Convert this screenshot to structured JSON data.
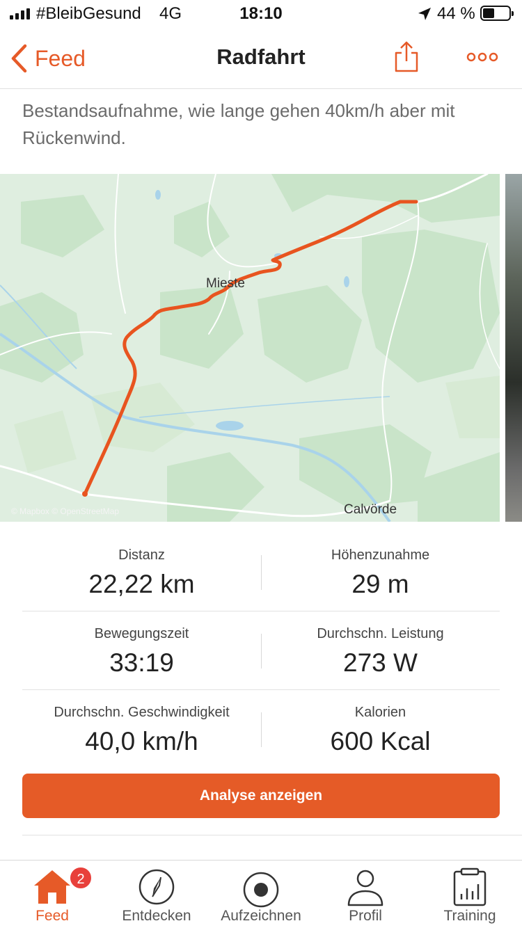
{
  "status_bar": {
    "carrier": "#BleibGesund",
    "network": "4G",
    "time": "18:10",
    "battery_percent": "44 %"
  },
  "nav": {
    "back_label": "Feed",
    "title": "Radfahrt"
  },
  "description": "Bestandsaufnahme, wie lange gehen 40km/h aber mit Rückenwind.",
  "map": {
    "labels": {
      "town_miesté": "Mieste",
      "town_calvoerde": "Calvörde"
    },
    "attribution": "© Mapbox © OpenStreetMap"
  },
  "stats": [
    {
      "left_label": "Distanz",
      "left_value": "22,22 km",
      "right_label": "Höhenzunahme",
      "right_value": "29 m"
    },
    {
      "left_label": "Bewegungszeit",
      "left_value": "33:19",
      "right_label": "Durchschn. Leistung",
      "right_value": "273 W"
    },
    {
      "left_label": "Durchschn. Geschwindigkeit",
      "left_value": "40,0 km/h",
      "right_label": "Kalorien",
      "right_value": "600 Kcal"
    }
  ],
  "analyse_button": "Analyse anzeigen",
  "tabs": [
    {
      "label": "Feed",
      "icon": "home-icon",
      "badge": "2",
      "active": true
    },
    {
      "label": "Entdecken",
      "icon": "compass-icon"
    },
    {
      "label": "Aufzeichnen",
      "icon": "record-icon"
    },
    {
      "label": "Profil",
      "icon": "profile-icon"
    },
    {
      "label": "Training",
      "icon": "training-icon"
    }
  ],
  "colors": {
    "accent": "#e65a28",
    "route": "#e8541f",
    "map_background": "#dfeee0",
    "forest": "#c7e3c8",
    "water": "#a9d3ea",
    "badge": "#e8403b"
  }
}
